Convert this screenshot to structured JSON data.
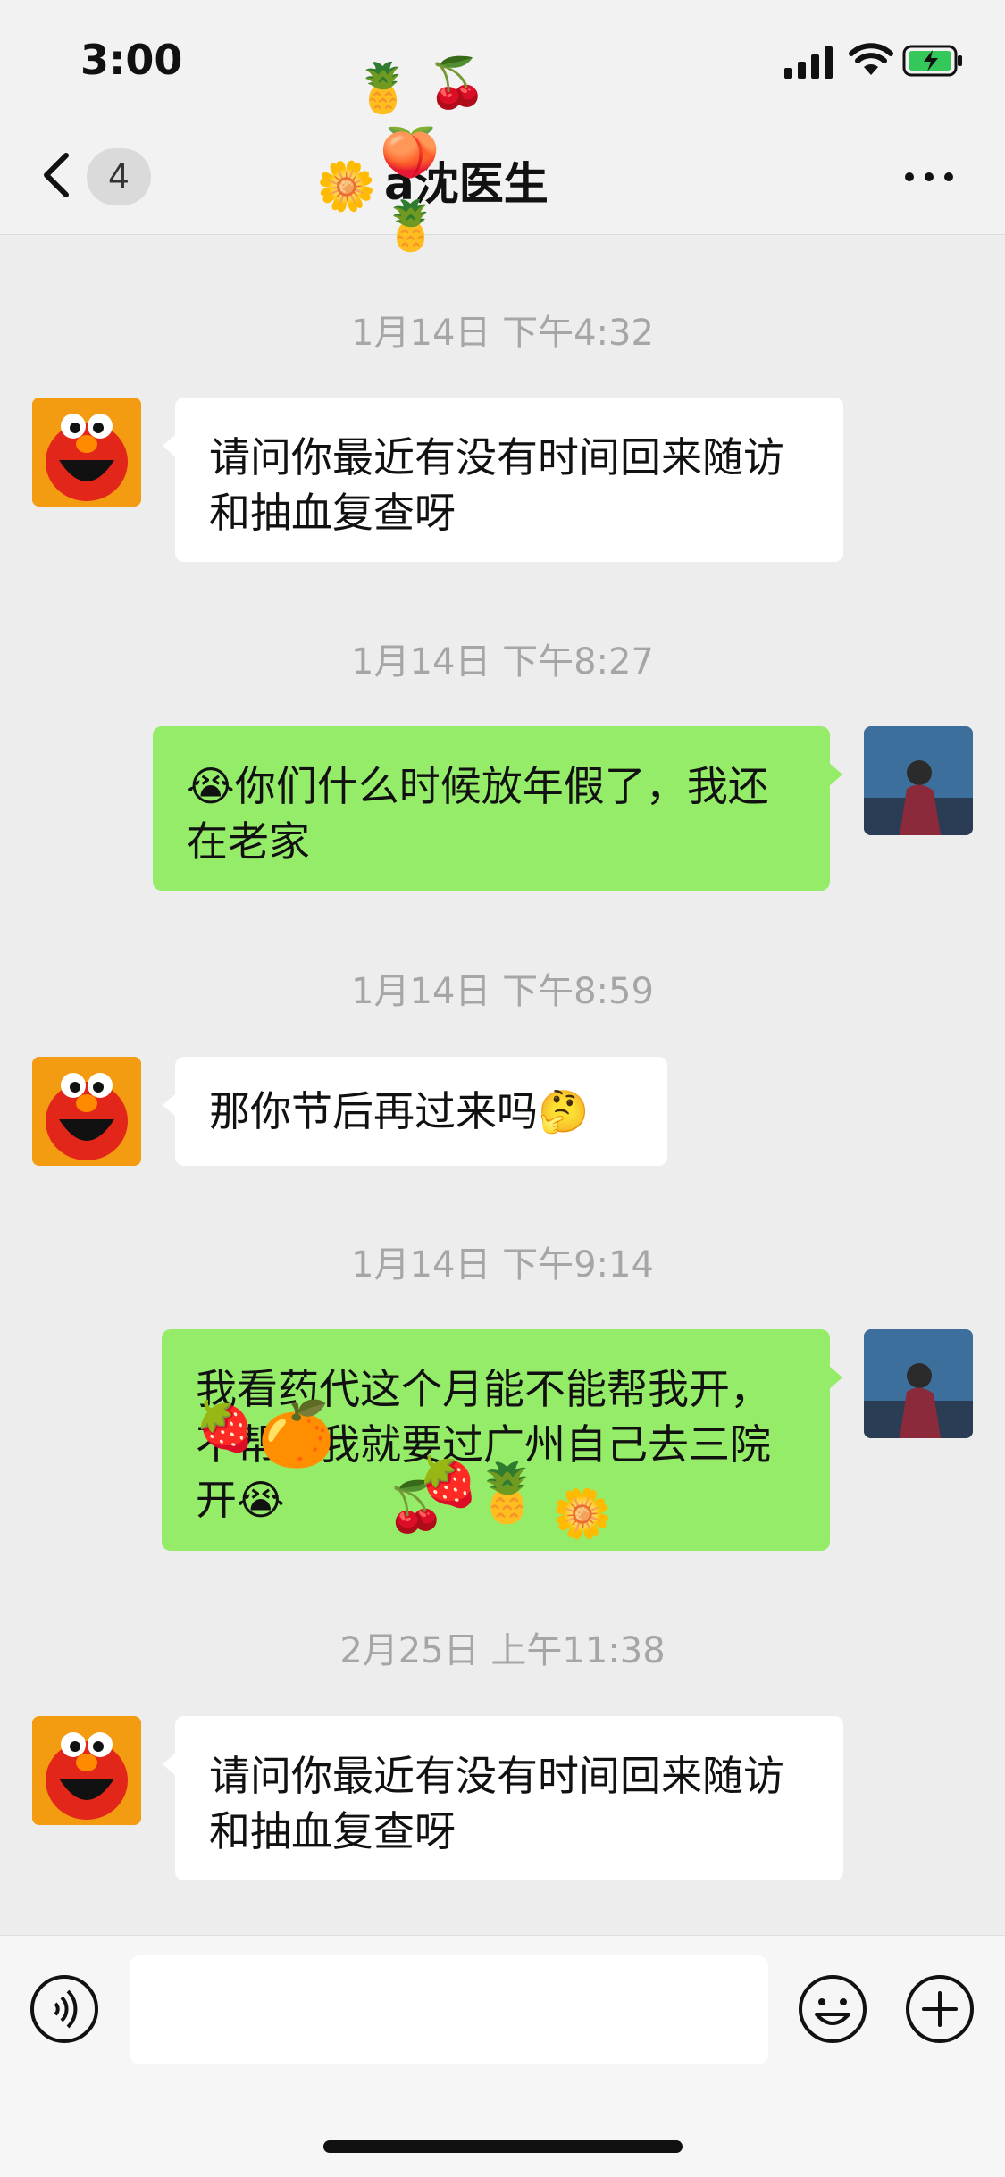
{
  "status_bar": {
    "time": "3:00"
  },
  "nav": {
    "unread_count": "4",
    "title": "a沈医生",
    "sticker_icons": [
      "fruit-sticker-icon",
      "cherry-sticker-icon",
      "flower-sticker-icon",
      "pineapple-sticker-icon"
    ]
  },
  "messages": [
    {
      "timestamp": "1月14日 下午4:32",
      "side": "left",
      "avatar": "elmo-avatar",
      "text": "请问你最近有没有时间回来随访和抽血复查呀"
    },
    {
      "timestamp": "1月14日 下午8:27",
      "side": "right",
      "avatar": "user-avatar",
      "text": "😭你们什么时候放年假了，我还在老家"
    },
    {
      "timestamp": "1月14日 下午8:59",
      "side": "left",
      "avatar": "elmo-avatar",
      "text": "那你节后再过来吗🤔"
    },
    {
      "timestamp": "1月14日 下午9:14",
      "side": "right",
      "avatar": "user-avatar",
      "text": "我看药代这个月能不能帮我开，不帮开我就要过广州自己去三院开😭",
      "overlay_stickers": [
        "strawberry-sticker-icon",
        "orange-sticker-icon",
        "cherry-sticker-icon",
        "strawberry-sticker-icon",
        "pig-pineapple-sticker-icon",
        "flower-sticker-icon"
      ]
    },
    {
      "timestamp": "2月25日 上午11:38",
      "side": "left",
      "avatar": "elmo-avatar",
      "text": "请问你最近有没有时间回来随访和抽血复查呀"
    }
  ],
  "input_bar": {
    "placeholder": ""
  },
  "colors": {
    "background": "#ededed",
    "bubble_right": "#95ec69",
    "bubble_left": "#ffffff",
    "timestamp": "#a6a6a6"
  }
}
